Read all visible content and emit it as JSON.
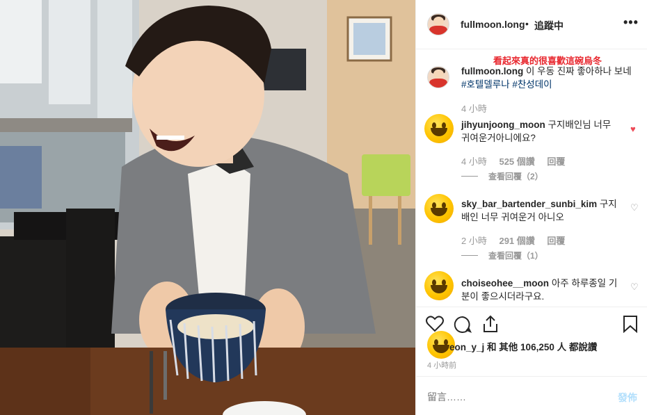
{
  "header": {
    "username": "fullmoon.long",
    "dot": "•",
    "follow_label": "追蹤中",
    "more_icon": "more-options-icon"
  },
  "overlay_caption": "看起來真的很喜歡這碗烏冬",
  "post_caption": {
    "username": "fullmoon.long",
    "text": "이 우동 진짜 좋아하나 보네",
    "tags": "#호텔델루나 #찬성데이",
    "time": "4 小時"
  },
  "comments": [
    {
      "username": "jihyunjoong_moon",
      "text_line1": "구지배인님 너무",
      "text_line2": "귀여운거아니에요?",
      "time": "4 小時",
      "likes": "525 個讚",
      "reply": "回覆",
      "view_replies": "查看回覆（2）",
      "liked": true
    },
    {
      "username": "sky_bar_bartender_sunbi_kim",
      "text_line1": "구지",
      "text_line2": "배인 너무 귀여운거 아니오",
      "time": "2 小時",
      "likes": "291 個讚",
      "reply": "回覆",
      "view_replies": "查看回覆（1）",
      "liked": false
    },
    {
      "username": "choiseohee__moon",
      "text_line1": "아주 하루종일 기",
      "text_line2": "분이 좋으시더라구요.",
      "liked": false
    }
  ],
  "likes_line": {
    "user_fragment": "eon_y_j",
    "rest": "和 其他 106,250 人 都說讚"
  },
  "post_time": "4 小時前",
  "add_comment": {
    "placeholder": "留言……",
    "post_label": "發佈"
  },
  "colors": {
    "red_caption": "#e8262d",
    "heart_red": "#ed4956",
    "hashtag": "#003569",
    "post_button": "#b2dffc"
  }
}
